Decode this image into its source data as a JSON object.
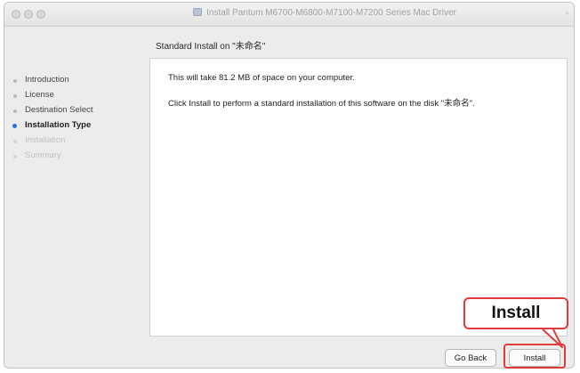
{
  "window": {
    "title": "Install Pantum M6700-M6800-M7100-M7200 Series Mac Driver"
  },
  "header": {
    "subtitle": "Standard Install on \"未命名\""
  },
  "sidebar": {
    "steps": [
      {
        "label": "Introduction",
        "state": "done"
      },
      {
        "label": "License",
        "state": "done"
      },
      {
        "label": "Destination Select",
        "state": "done"
      },
      {
        "label": "Installation Type",
        "state": "current"
      },
      {
        "label": "Installation",
        "state": "todo"
      },
      {
        "label": "Summary",
        "state": "todo"
      }
    ]
  },
  "main": {
    "line1": "This will take 81.2 MB of space on your computer.",
    "line2": "Click Install to perform a standard installation of this software on the disk \"未命名\"."
  },
  "buttons": {
    "go_back": "Go Back",
    "install": "Install"
  },
  "annotation": {
    "label": "Install",
    "color": "#e03a3a"
  },
  "colors": {
    "accent": "#2c6fe0"
  }
}
